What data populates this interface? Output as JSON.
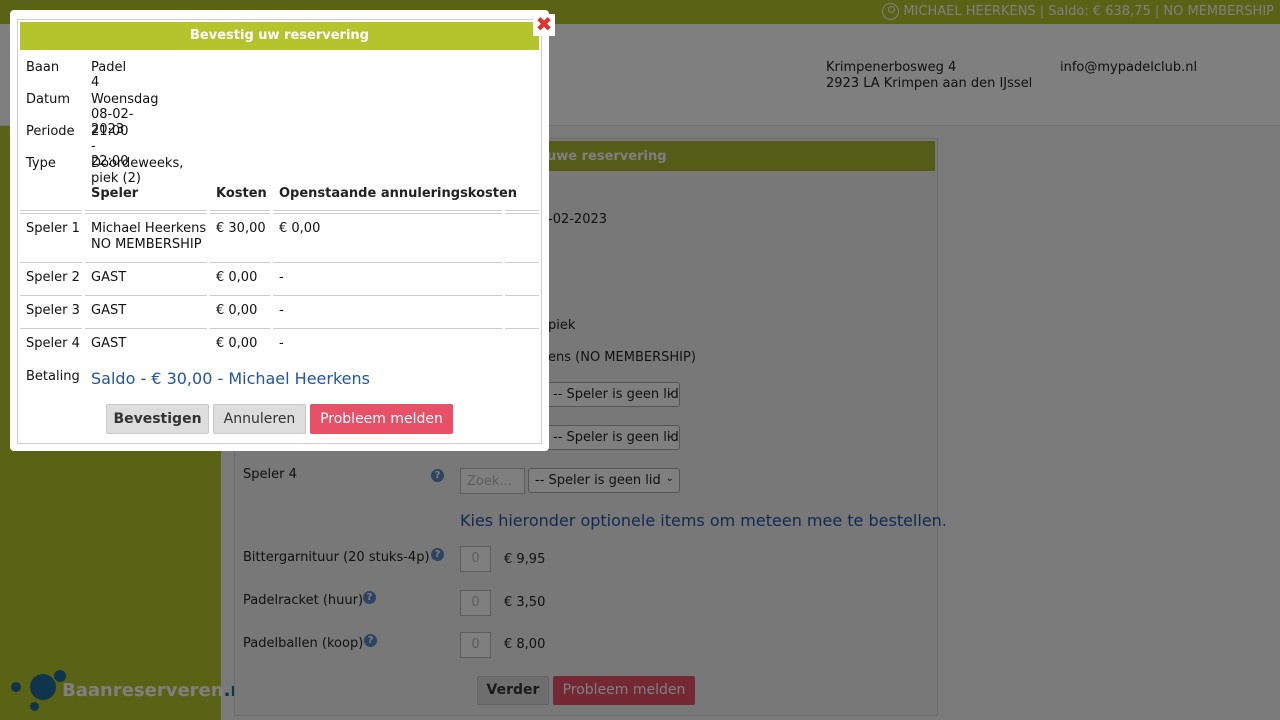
{
  "topbar": {
    "user_text": "MICHAEL HEERKENS | Saldo: € 638,75 | NO MEMBERSHIP"
  },
  "header": {
    "address_line1": "Krimpenerbosweg 4",
    "address_line2": "2923 LA Krimpen aan den IJssel",
    "email": "info@mypadelclub.nl"
  },
  "logo": {
    "text": "Baanreserveren",
    "suffix": ".nl"
  },
  "background_form": {
    "title_fragment": "uwe reservering",
    "datum_fragment": "-02-2023",
    "type_fragment": "piek",
    "speler1_fragment": "ens (NO MEMBERSHIP)",
    "speler_select": "-- Speler is geen lid",
    "speler4_label": "Speler 4",
    "search_placeholder": "Zoek...",
    "optional_items_text": "Kies hieronder optionele items om meteen mee te bestellen.",
    "items": [
      {
        "label": "Bittergarnituur (20 stuks-4p)",
        "qty": "0",
        "price": "€ 9,95"
      },
      {
        "label": "Padelracket (huur)",
        "qty": "0",
        "price": "€ 3,50"
      },
      {
        "label": "Padelballen (koop)",
        "qty": "0",
        "price": "€ 8,00"
      }
    ],
    "next_button": "Verder",
    "report_button": "Probleem melden"
  },
  "dialog": {
    "title": "Bevestig uw reservering",
    "close_glyph": "✖",
    "fields": [
      {
        "label": "Baan",
        "value": "Padel 4"
      },
      {
        "label": "Datum",
        "value": "Woensdag 08-02-2023"
      },
      {
        "label": "Periode",
        "value": "21:00 - 22:00"
      },
      {
        "label": "Type",
        "value": "Doordeweeks, piek (2)"
      }
    ],
    "table_headers": {
      "player": "Speler",
      "cost": "Kosten",
      "cancel_cost": "Openstaande annuleringskosten"
    },
    "players": [
      {
        "label": "Speler 1",
        "name": "Michael Heerkens",
        "membership": "NO MEMBERSHIP",
        "cost": "€ 30,00",
        "cancel": "€ 0,00"
      },
      {
        "label": "Speler 2",
        "name": "GAST",
        "cost": "€ 0,00",
        "cancel": "-"
      },
      {
        "label": "Speler 3",
        "name": "GAST",
        "cost": "€ 0,00",
        "cancel": "-"
      },
      {
        "label": "Speler 4",
        "name": "GAST",
        "cost": "€ 0,00",
        "cancel": "-"
      }
    ],
    "payment_label": "Betaling",
    "payment_value": "Saldo - € 30,00 - Michael Heerkens",
    "buttons": {
      "confirm": "Bevestigen",
      "cancel": "Annuleren",
      "report": "Probleem melden"
    }
  },
  "colors": {
    "brand_green": "#b4c42c",
    "accent_red": "#e85068",
    "link_blue": "#2255a0"
  }
}
